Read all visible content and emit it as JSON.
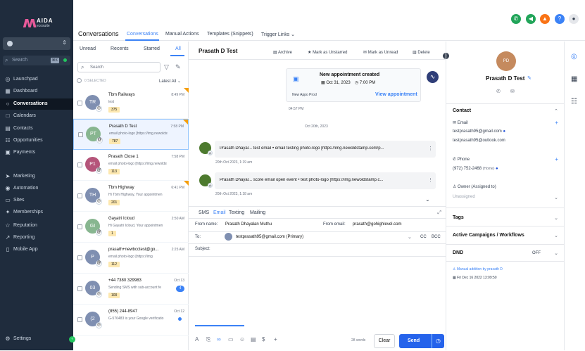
{
  "brand": {
    "logo_mark": "ʍ",
    "name": "AIDA",
    "tagline": "ecosuite"
  },
  "sidebar": {
    "search_label": "Search",
    "search_shortcut": "⌘K",
    "items": [
      {
        "label": "Launchpad",
        "icon": "◎"
      },
      {
        "label": "Dashboard",
        "icon": "▦"
      },
      {
        "label": "Conversations",
        "icon": "○"
      },
      {
        "label": "Calendars",
        "icon": "□"
      },
      {
        "label": "Contacts",
        "icon": "▤"
      },
      {
        "label": "Opportunities",
        "icon": "☷"
      },
      {
        "label": "Payments",
        "icon": "▣"
      },
      {
        "label": "Marketing",
        "icon": "➤"
      },
      {
        "label": "Automation",
        "icon": "◉"
      },
      {
        "label": "Sites",
        "icon": "▭"
      },
      {
        "label": "Memberships",
        "icon": "✦"
      },
      {
        "label": "Reputation",
        "icon": "☆"
      },
      {
        "label": "Reporting",
        "icon": "↗"
      },
      {
        "label": "Mobile App",
        "icon": "▯"
      }
    ],
    "settings_label": "Settings",
    "settings_icon": "⚙",
    "collapse_icon": "‹"
  },
  "topbar": {
    "icons": [
      {
        "name": "phone",
        "glyph": "✆",
        "color": "#22a55a"
      },
      {
        "name": "megaphone",
        "glyph": "◀",
        "color": "#22a55a"
      },
      {
        "name": "bell",
        "glyph": "▲",
        "color": "#f97316"
      },
      {
        "name": "help",
        "glyph": "?",
        "color": "#3b82f6"
      },
      {
        "name": "user",
        "glyph": "●",
        "color": "#e5e7eb"
      }
    ]
  },
  "header": {
    "title": "Conversations",
    "tabs": [
      "Conversations",
      "Manual Actions",
      "Templates (Snippets)",
      "Trigger Links ⌄"
    ]
  },
  "list": {
    "tabs": [
      "Unread",
      "Recents",
      "Starred",
      "All"
    ],
    "search_placeholder": "Search",
    "select_label": "0 SELECTED",
    "sort_label": "Latest All ⌄",
    "items": [
      {
        "initials": "TR",
        "name": "Tbm Railways",
        "preview": "test",
        "time": "8:49 PM",
        "badge": "375",
        "color": "#7f8fb1",
        "flag": true,
        "channel": "◎"
      },
      {
        "initials": "PT",
        "name": "Prasath D Test",
        "preview": "email photo-logo [https://img.newoldst",
        "time": "7:58 PM",
        "badge": "787",
        "color": "#88b690",
        "flag": true,
        "channel": "@"
      },
      {
        "initials": "P1",
        "name": "Prasath Close 1",
        "preview": "email photo-logo [https://img.newoldst",
        "time": "7:58 PM",
        "badge": "113",
        "color": "#b5557a",
        "flag": false,
        "channel": "@"
      },
      {
        "initials": "TH",
        "name": "Tbm Highway",
        "preview": "Hi Tbm Highway, Your appointmen",
        "time": "6:41 PM",
        "badge": "201",
        "color": "#7f8fb1",
        "flag": true,
        "channel": "◎"
      },
      {
        "initials": "GI",
        "name": "Gayatri Icloud",
        "preview": "Hi Gayatri Icloud, Your appointmen",
        "time": "2:50 AM",
        "badge": "1",
        "color": "#88b690",
        "flag": false,
        "channel": "@"
      },
      {
        "initials": "P",
        "name": "prasath+newbcctest@go...",
        "preview": "email photo-logo [https://img",
        "time": "2:25 AM",
        "badge": "112",
        "color": "#7f8fb1",
        "flag": false,
        "channel": "@"
      },
      {
        "initials": "03",
        "name": "+44 7380 329983",
        "preview": "Sending SMS with sub-account fe",
        "time": "Oct 13",
        "badge": "100",
        "color": "#7f8fb1",
        "flag": false,
        "channel": "◎",
        "count": "4"
      },
      {
        "initials": "(2",
        "name": "(855) 244-8947",
        "preview": "G-576483 is your Google verificatio",
        "time": "Oct 12",
        "badge": "",
        "color": "#7f8fb1",
        "flag": false,
        "channel": "◎",
        "dot": true
      }
    ]
  },
  "conversation": {
    "name": "Prasath D Test",
    "actions": [
      "Archive",
      "Mark as Unstarred",
      "Mark as Unread",
      "Delete"
    ],
    "action_icons": [
      "▤",
      "★",
      "✉",
      "▥"
    ],
    "appointment": {
      "title": "New appointment created",
      "date": "Oct 31, 2023",
      "time": "7:00 PM",
      "source": "New Appo Prod",
      "link": "View appointment"
    },
    "appt_time": "04:57 PM",
    "date_divider": "Oct 20th, 2023",
    "messages": [
      {
        "text": "Prasath Dhayal...  test email • email testing photo-logo [https://img.newoldstamp.com/p...",
        "time": "20th Oct 2023, 1:19 am"
      },
      {
        "text": "Prasath Dhayal...  score email open event • test photo-logo [https://img.newoldstamp.c...",
        "time": "20th Oct 2023, 1:18 am"
      }
    ]
  },
  "composer": {
    "tabs": [
      "SMS",
      "Email",
      "Texting",
      "Mailing"
    ],
    "from_name_label": "From name:",
    "from_name": "Prasath Dhayalan Muthu",
    "from_email_label": "From email:",
    "from_email": "prasath@gohighlevel.com",
    "to_label": "To:",
    "to_value": "testprasath95@gmail.com (Primary)",
    "cc": "CC",
    "bcc": "BCC",
    "subject_label": "Subject:",
    "word_count": "28 words",
    "clear_label": "Clear",
    "send_label": "Send",
    "tool_icons": [
      "A",
      "⎘",
      "∞",
      "▭",
      "☺",
      "▤",
      "$",
      "+"
    ]
  },
  "contact": {
    "initials": "PD",
    "name": "Prasath D Test",
    "section_contact": "Contact",
    "email_label": "Email",
    "emails": [
      "testprasath95@gmail.com",
      "testprasath95@outlook.com"
    ],
    "phone_label": "Phone",
    "phone": "(972) 752-2468",
    "phone_type": "(Home)",
    "owner_label": "Owner (Assigned to)",
    "owner_value": "Unassigned",
    "sections": [
      "Tags",
      "Active Campaigns / Workflows",
      "DND"
    ],
    "dnd_value": "OFF",
    "manual_note": "Manual addition by prasath D",
    "created": "Fri Dec 16 2022 13:09:50"
  },
  "strip_icons": [
    "◎",
    "▦",
    "☷"
  ]
}
